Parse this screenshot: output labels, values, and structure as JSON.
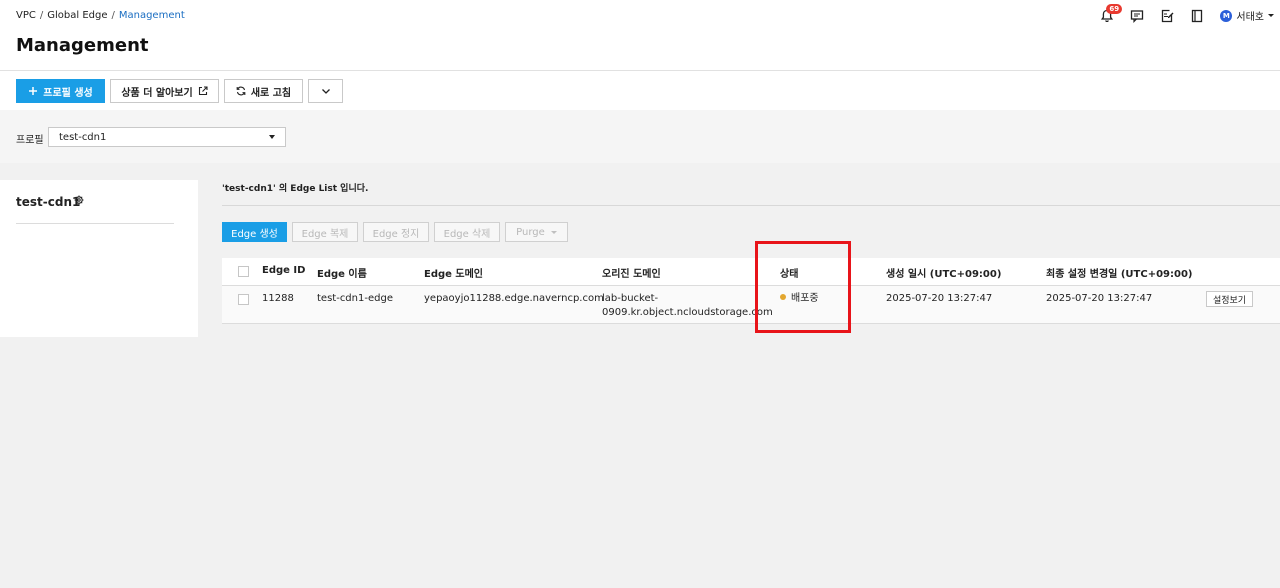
{
  "breadcrumb": {
    "item1": "VPC",
    "item2": "Global Edge",
    "item3": "Management",
    "separator": "/"
  },
  "page_title": "Management",
  "header": {
    "notification_count": "69",
    "user_initial": "M",
    "user_name": "서태호"
  },
  "toolbar": {
    "create_profile": "프로필 생성",
    "learn_more": "상품 더 알아보기",
    "refresh": "새로 고침"
  },
  "profile": {
    "label": "프로필",
    "selected": "test-cdn1"
  },
  "left_panel": {
    "title": "test-cdn1"
  },
  "list": {
    "caption": "'test-cdn1' 의 Edge List 입니다.",
    "actions": {
      "create": "Edge 생성",
      "copy": "Edge 복제",
      "stop": "Edge 정지",
      "delete": "Edge 삭제",
      "purge": "Purge"
    },
    "columns": {
      "edge_id": "Edge ID",
      "edge_name": "Edge 이름",
      "edge_domain": "Edge 도메인",
      "origin_domain": "오리진 도메인",
      "status": "상태",
      "created_at": "생성 일시 (UTC+09:00)",
      "updated_at": "최종 설정 변경일 (UTC+09:00)"
    },
    "rows": [
      {
        "edge_id": "11288",
        "edge_name": "test-cdn1-edge",
        "edge_domain": "yepaoyjo11288.edge.naverncp.com",
        "origin_domain_line1": "lab-bucket-",
        "origin_domain_line2": "0909.kr.object.ncloudstorage.com",
        "status": "배포중",
        "created_at": "2025-07-20 13:27:47",
        "updated_at": "2025-07-20 13:27:47",
        "view_button": "설정보기"
      }
    ]
  },
  "colors": {
    "primary": "#1a9ee6",
    "highlight": "#e8141a",
    "status_deploying": "#e3a72f",
    "badge": "#e8392f"
  }
}
